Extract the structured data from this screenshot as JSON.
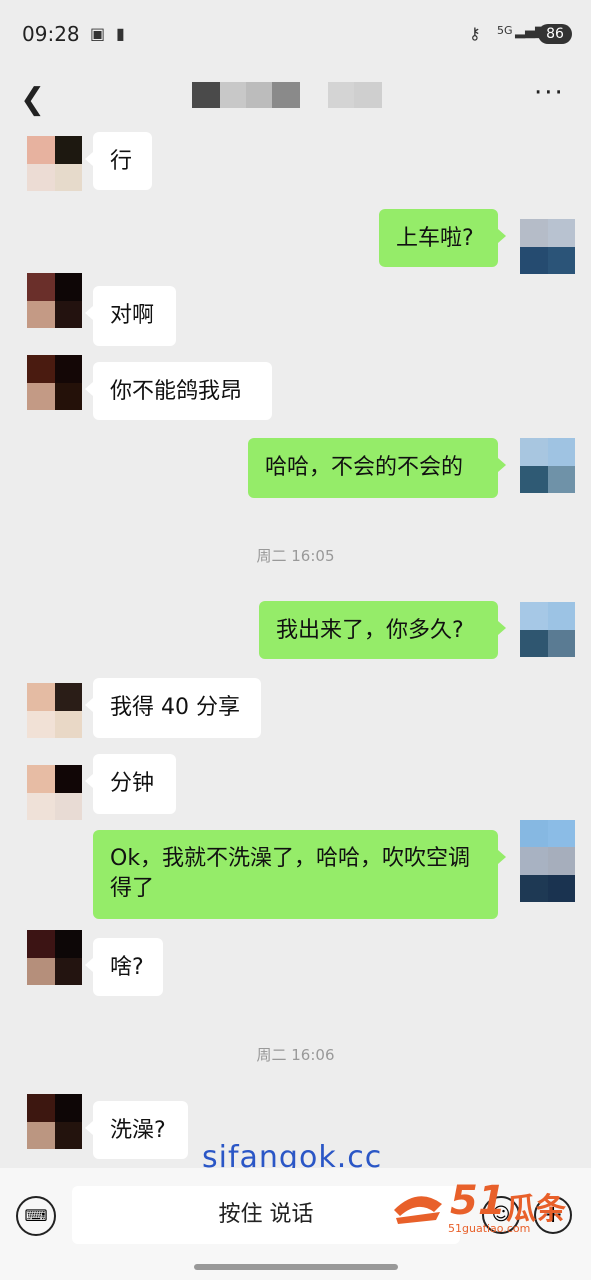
{
  "status_bar": {
    "time": "09:28",
    "network": "5G",
    "battery": "86"
  },
  "header": {
    "back_icon": "chevron-left-icon",
    "more_icon": "ellipsis-icon"
  },
  "messages": [
    {
      "side": "left",
      "text": "行"
    },
    {
      "side": "right",
      "text": "上车啦?"
    },
    {
      "side": "left",
      "text": "对啊"
    },
    {
      "side": "left",
      "text": "你不能鸽我昂"
    },
    {
      "side": "right",
      "text": "哈哈，不会的不会的"
    },
    {
      "side": "right",
      "text": "我出来了，你多久?"
    },
    {
      "side": "left",
      "text": "我得 40 分享"
    },
    {
      "side": "left",
      "text": "分钟"
    },
    {
      "side": "right",
      "text": "Ok，我就不洗澡了，哈哈，吹吹空调得了"
    },
    {
      "side": "left",
      "text": "啥?"
    },
    {
      "side": "left",
      "text": "洗澡?"
    }
  ],
  "timestamps": [
    "周二 16:05",
    "周二 16:06"
  ],
  "watermark": "sifangok.cc",
  "input_bar": {
    "voice_icon": "keyboard-icon",
    "talk_label": "按住 说话",
    "emoji_icon": "smiley-icon",
    "plus_icon": "plus-icon"
  },
  "logo": {
    "number": "51",
    "text": "瓜条",
    "url": "51guatiao.com"
  }
}
